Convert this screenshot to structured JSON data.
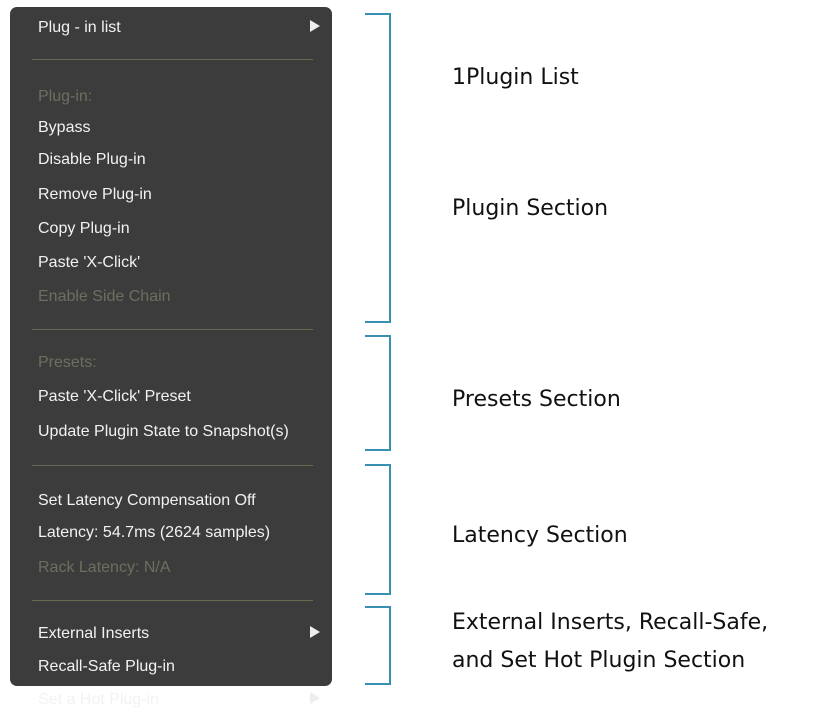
{
  "menu": {
    "plugin_list": {
      "label": "Plug - in list",
      "icon": "submenu-arrow-icon"
    },
    "plugin_section": {
      "header": "Plug-in:",
      "items": [
        "Bypass",
        "Disable Plug-in",
        "Remove Plug-in",
        "Copy Plug-in",
        "Paste 'X-Click'"
      ],
      "disabled_item": "Enable Side Chain"
    },
    "presets_section": {
      "header": "Presets:",
      "items": [
        "Paste 'X-Click' Preset",
        "Update Plugin State to Snapshot(s)"
      ]
    },
    "latency_section": {
      "items": [
        "Set Latency Compensation Off",
        "Latency: 54.7ms (2624 samples)"
      ],
      "disabled_item": "Rack Latency: N/A"
    },
    "external_section": {
      "external_inserts": "External Inserts",
      "recall_safe": "Recall-Safe Plug-in",
      "hot_plugin": "Set a Hot Plug-in"
    }
  },
  "annotations": {
    "plugin_list": "1Plugin List",
    "plugin_section": "Plugin Section",
    "presets_section": "Presets Section",
    "latency_section": "Latency Section",
    "external_line1": "External Inserts, Recall-Safe,",
    "external_line2": "and Set Hot Plugin Section"
  },
  "colors": {
    "menu_background": "#3c3c3c",
    "menu_text": "#f2f2f2",
    "disabled_text": "#6e6e60",
    "separator": "#6a6a52",
    "bracket": "#3a8fb5"
  }
}
